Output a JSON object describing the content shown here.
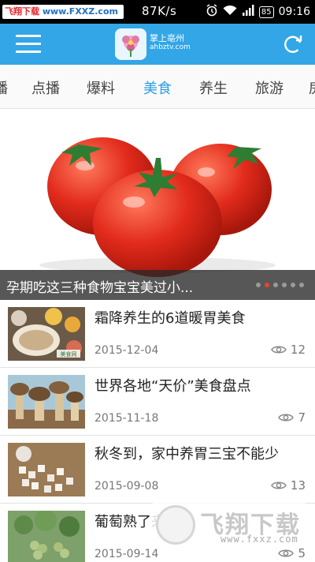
{
  "watermark_top": {
    "part1": "飞翔下载",
    "part2": "www.FXXZ.com"
  },
  "status_bar": {
    "net_speed": "87K/s",
    "battery": "85",
    "time": "09:16"
  },
  "header": {
    "brand_title": "掌上亳州",
    "brand_sub": "ahbztv.com"
  },
  "tabs": [
    {
      "label": "播"
    },
    {
      "label": "点播"
    },
    {
      "label": "爆料"
    },
    {
      "label": "美食",
      "active": true
    },
    {
      "label": "养生"
    },
    {
      "label": "旅游"
    },
    {
      "label": "房"
    }
  ],
  "banner": {
    "caption": "孕期吃这三种食物宝宝美过小...",
    "slide_count": 6,
    "active_slide": 1
  },
  "articles": [
    {
      "title": "霜降养生的6道暖胃美食",
      "date": "2015-12-04",
      "views": "12",
      "thumb_label": "美食网"
    },
    {
      "title": "世界各地“天价”美食盘点",
      "date": "2015-11-18",
      "views": "7"
    },
    {
      "title": "秋冬到，家中养胃三宝不能少",
      "date": "2015-09-08",
      "views": "13"
    },
    {
      "title": "葡萄熟了来采摘",
      "date": "2015-09-14",
      "views": "5"
    }
  ],
  "watermark_bottom": {
    "main": "飞翔下载",
    "sub": "www.fxxz.com"
  }
}
